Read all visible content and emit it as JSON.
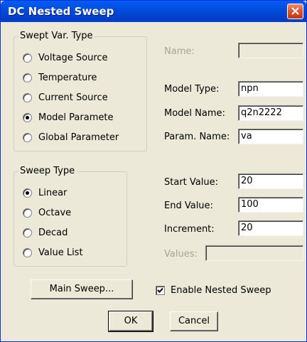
{
  "window": {
    "title": "DC Nested Sweep"
  },
  "swept_var_type": {
    "title": "Swept Var. Type",
    "options": [
      "Voltage Source",
      "Temperature",
      "Current Source",
      "Model Paramete",
      "Global Parameter"
    ],
    "selected_index": 3
  },
  "sweep_type": {
    "title": "Sweep Type",
    "options": [
      "Linear",
      "Octave",
      "Decad",
      "Value List"
    ],
    "selected_index": 0
  },
  "fields": {
    "name_label": "Name:",
    "name_value": "",
    "model_type_label": "Model Type:",
    "model_type_value": "npn",
    "model_name_label": "Model Name:",
    "model_name_value": "q2n2222",
    "param_name_label": "Param. Name:",
    "param_name_value": "va",
    "start_label": "Start Value:",
    "start_value": "20",
    "end_label": "End Value:",
    "end_value": "100",
    "increment_label": "Increment:",
    "increment_value": "20",
    "values_label": "Values:",
    "values_value": ""
  },
  "buttons": {
    "main_sweep": "Main Sweep...",
    "ok": "OK",
    "cancel": "Cancel"
  },
  "enable_nested": {
    "label": "Enable Nested Sweep",
    "checked": true
  },
  "colors": {
    "title_bar": "#0054e3",
    "face": "#ece9d8",
    "close": "#e2542b"
  },
  "icons": {
    "close": "close-icon",
    "check": "checkmark-icon"
  }
}
